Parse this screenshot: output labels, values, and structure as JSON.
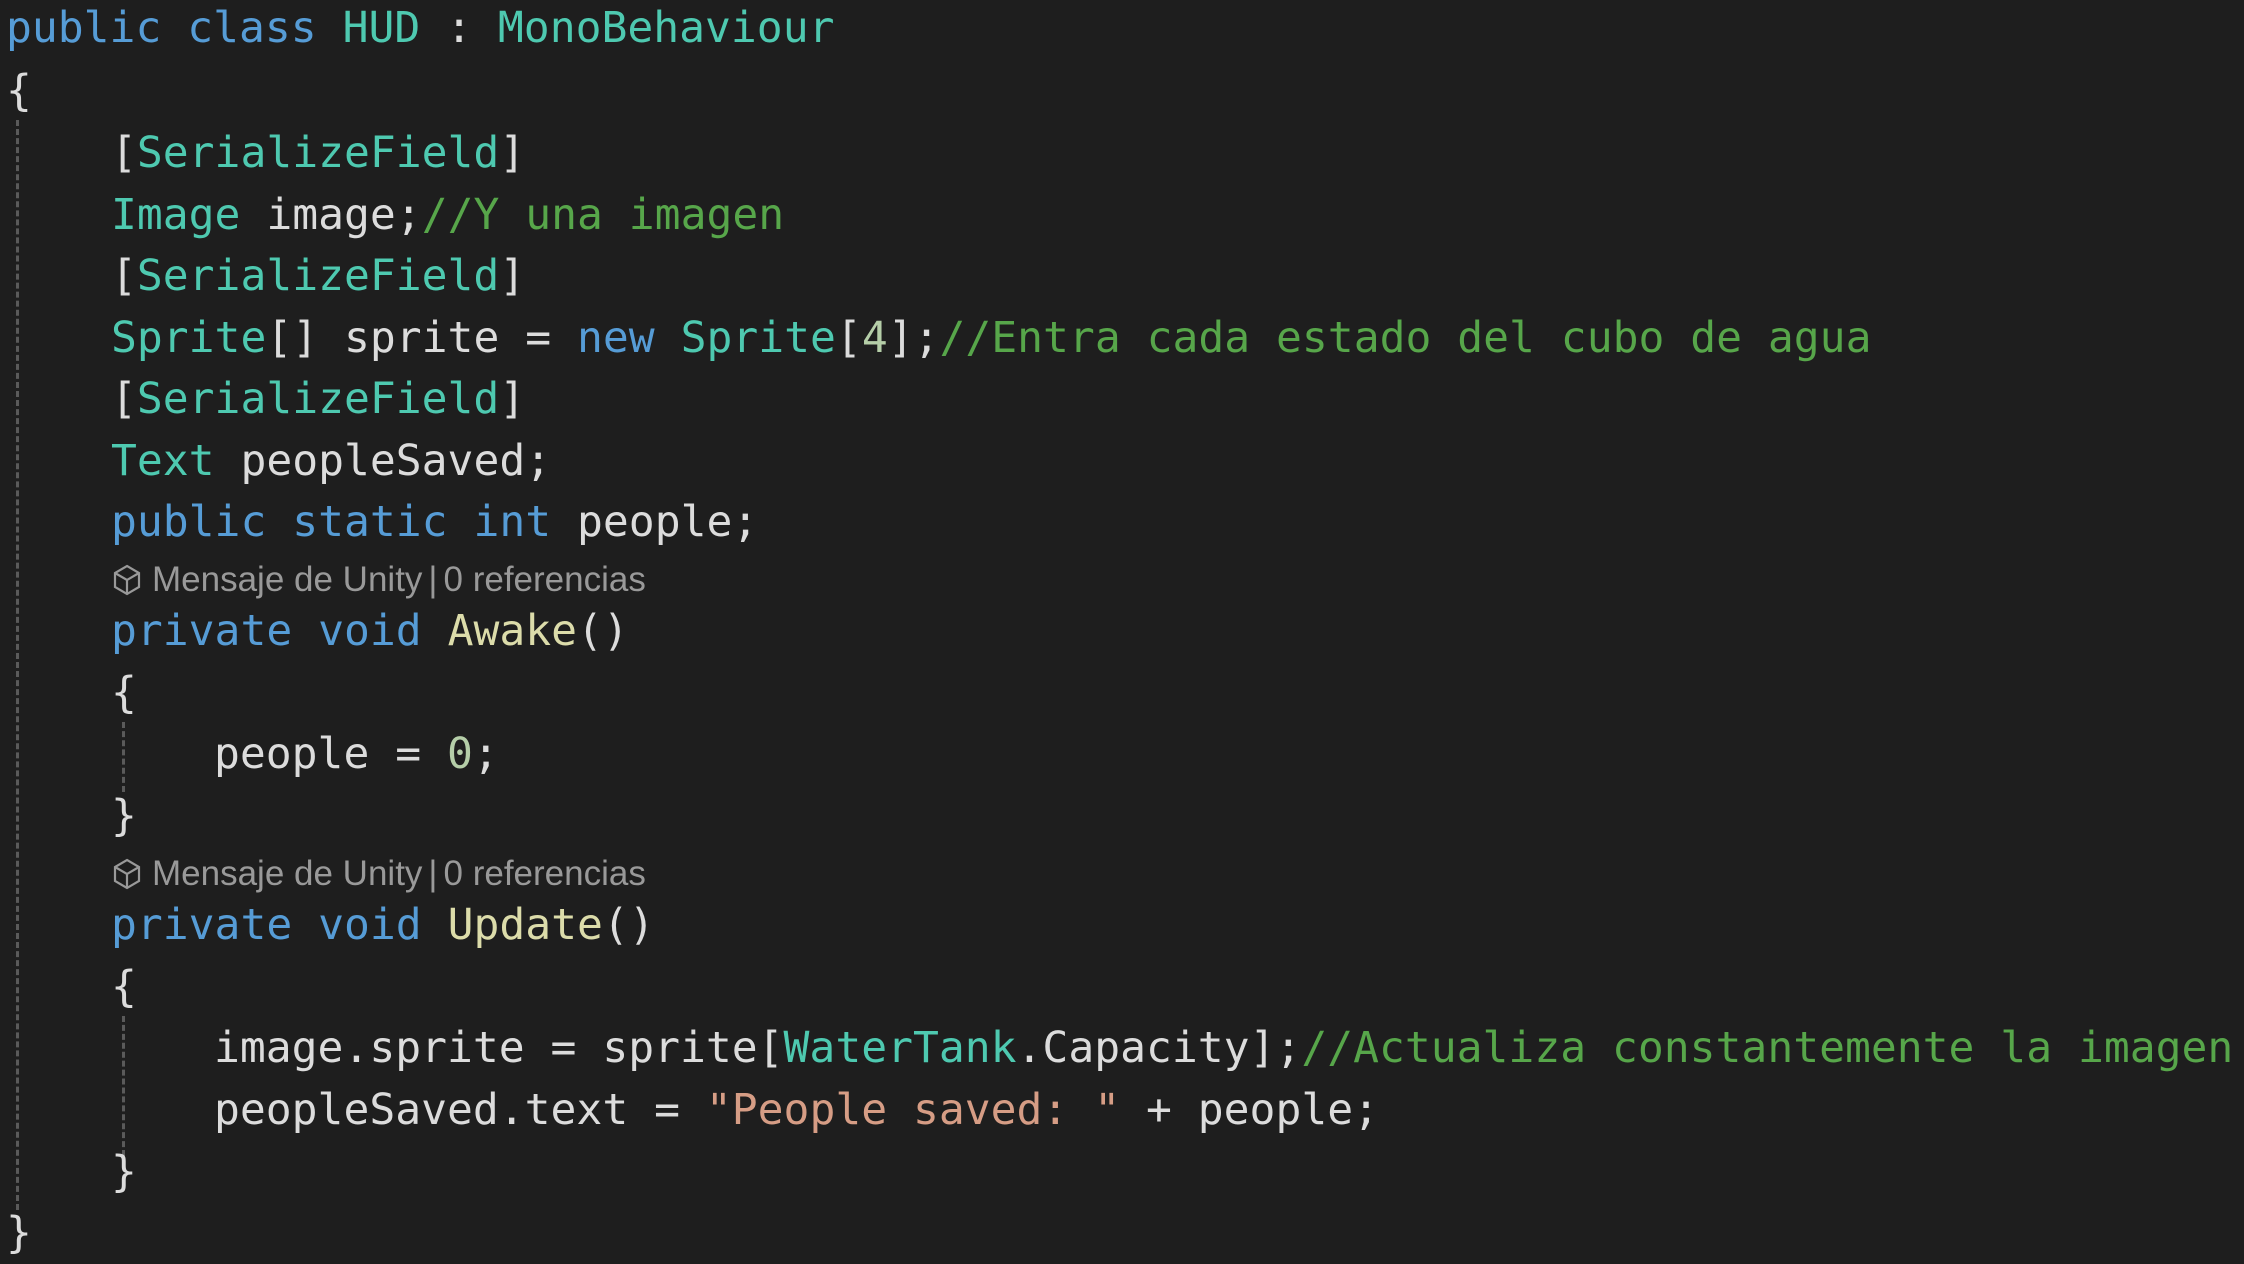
{
  "colors": {
    "background": "#1e1e1e",
    "keyword": "#569cd6",
    "type": "#4ec9b0",
    "comment": "#57a64a",
    "string": "#d69d85",
    "number": "#b5cea8",
    "method": "#dcdcaa",
    "plain": "#dcdcdc",
    "codelens": "#999999"
  },
  "code": {
    "l1": {
      "kw1": "public",
      "kw2": "class",
      "cls": "HUD",
      "colon": ":",
      "base": "MonoBehaviour"
    },
    "l2": {
      "brace": "{"
    },
    "l3": {
      "attr_open": "[",
      "attr": "SerializeField",
      "attr_close": "]"
    },
    "l4": {
      "type": "Image",
      "rest": "image;",
      "comment": "//Y una imagen"
    },
    "l5": {
      "attr_open": "[",
      "attr": "SerializeField",
      "attr_close": "]"
    },
    "l6": {
      "type": "Sprite",
      "a": "[] sprite = ",
      "kw": "new",
      "type2": "Sprite",
      "b": "[",
      "num": "4",
      "c": "];",
      "comment": "//Entra cada estado del cubo de agua"
    },
    "l7": {
      "attr_open": "[",
      "attr": "SerializeField",
      "attr_close": "]"
    },
    "l8": {
      "type": "Text",
      "rest": "peopleSaved;"
    },
    "l9": {
      "kw1": "public",
      "kw2": "static",
      "kw3": "int",
      "rest": "people;"
    },
    "l10": {
      "kw1": "private",
      "kw2": "void",
      "method": "Awake",
      "parens": "()"
    },
    "l11": {
      "brace": "{"
    },
    "l12": {
      "a": "people = ",
      "num": "0",
      "b": ";"
    },
    "l13": {
      "brace": "}"
    },
    "l14": {
      "kw1": "private",
      "kw2": "void",
      "method": "Update",
      "parens": "()"
    },
    "l15": {
      "brace": "{"
    },
    "l16": {
      "a": "image.sprite = sprite[",
      "type": "WaterTank",
      "b": ".Capacity];",
      "comment": "//Actualiza constantemente la imagen"
    },
    "l17": {
      "a": "peopleSaved.text = ",
      "str": "\"People saved: \"",
      "b": " + people;"
    },
    "l18": {
      "brace": "}"
    },
    "l19": {
      "brace": "}"
    }
  },
  "codelens": {
    "awake": {
      "icon": "unity-cube-icon",
      "message": "Mensaje de Unity",
      "separator": "|",
      "refs": "0 referencias"
    },
    "update": {
      "icon": "unity-cube-icon",
      "message": "Mensaje de Unity",
      "separator": "|",
      "refs": "0 referencias"
    }
  }
}
